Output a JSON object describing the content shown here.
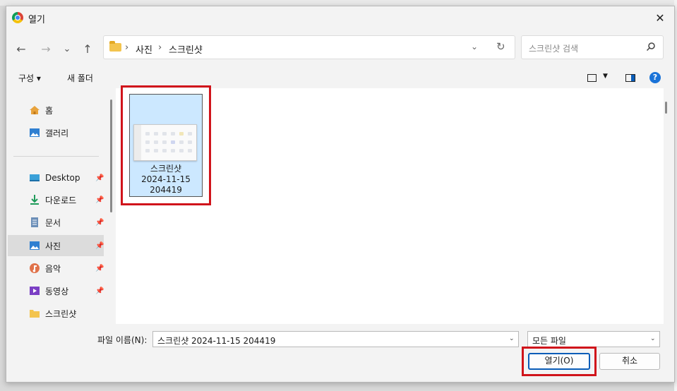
{
  "window": {
    "title": "열기",
    "close_glyph": "✕"
  },
  "nav": {
    "back": "←",
    "forward": "→",
    "recent": "⌄",
    "up": "↑"
  },
  "address": {
    "crumbs": [
      "사진",
      "스크린샷"
    ],
    "separator": "›",
    "dropdown": "⌄",
    "refresh": "↻"
  },
  "search": {
    "placeholder": "스크린샷 검색"
  },
  "toolbar": {
    "organize": "구성 ▾",
    "new_folder": "새 폴더",
    "help": "?",
    "view_dd": "▼"
  },
  "sidebar": {
    "items": [
      {
        "label": "홈",
        "icon": "home-icon"
      },
      {
        "label": "갤러리",
        "icon": "gallery-icon"
      },
      {
        "label": "Desktop",
        "icon": "desktop-icon",
        "pinned": true
      },
      {
        "label": "다운로드",
        "icon": "download-icon",
        "pinned": true
      },
      {
        "label": "문서",
        "icon": "document-icon",
        "pinned": true
      },
      {
        "label": "사진",
        "icon": "pictures-icon",
        "pinned": true,
        "selected": true
      },
      {
        "label": "음악",
        "icon": "music-icon",
        "pinned": true
      },
      {
        "label": "동영상",
        "icon": "video-icon",
        "pinned": true
      },
      {
        "label": "스크린샷",
        "icon": "folder-icon"
      }
    ],
    "pin_glyph": "📌"
  },
  "files": [
    {
      "name_line1": "스크린샷",
      "name_line2": "2024-11-15",
      "name_line3": "204419",
      "selected": true
    }
  ],
  "footer": {
    "filename_label": "파일 이름(N):",
    "filename_value": "스크린샷 2024-11-15 204419",
    "filetype_value": "모든 파일",
    "dropdown": "⌄",
    "open_button": "열기(O)",
    "cancel_button": "취소"
  },
  "colors": {
    "accent": "#0a5db8",
    "highlight": "#d0141b",
    "selection": "#cce8ff"
  }
}
